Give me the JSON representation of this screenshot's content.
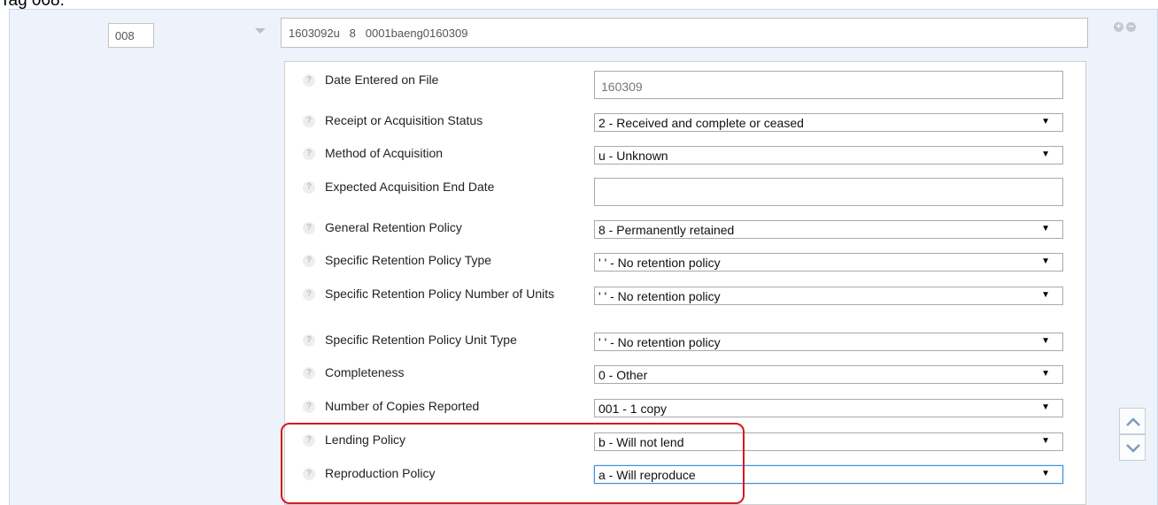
{
  "caption": "Tag 008:",
  "tag": {
    "code": "008",
    "value": "1603092u   8   0001baeng0160309"
  },
  "fields": [
    {
      "label": "Date Entered on File",
      "type": "text",
      "value": "160309"
    },
    {
      "label": "Receipt or Acquisition Status",
      "type": "select",
      "value": "2 - Received and complete or ceased"
    },
    {
      "label": "Method of Acquisition",
      "type": "select",
      "value": "u - Unknown"
    },
    {
      "label": "Expected Acquisition End Date",
      "type": "text",
      "value": ""
    },
    {
      "label": "General Retention Policy",
      "type": "select",
      "value": "8 - Permanently retained"
    },
    {
      "label": "Specific Retention Policy Type",
      "type": "select",
      "value": "' ' - No retention policy"
    },
    {
      "label": "Specific Retention Policy Number of Units",
      "type": "select",
      "value": "' ' - No retention policy"
    },
    {
      "label": "Specific Retention Policy Unit Type",
      "type": "select",
      "value": "' ' - No retention policy"
    },
    {
      "label": "Completeness",
      "type": "select",
      "value": "0 - Other"
    },
    {
      "label": "Number of Copies Reported",
      "type": "select",
      "value": "001 - 1 copy"
    },
    {
      "label": "Lending Policy",
      "type": "select",
      "value": "b - Will not lend"
    },
    {
      "label": "Reproduction Policy",
      "type": "select",
      "value": "a - Will reproduce"
    }
  ],
  "icons": {
    "help": "question-mark-icon",
    "add": "plus-circle-icon",
    "remove": "minus-circle-icon",
    "scroll_up": "chevron-up-icon",
    "scroll_down": "chevron-down-icon"
  },
  "colors": {
    "highlight": "#d61a1a",
    "panel_bg": "#eef3fb",
    "focus": "#3e8ddd"
  }
}
